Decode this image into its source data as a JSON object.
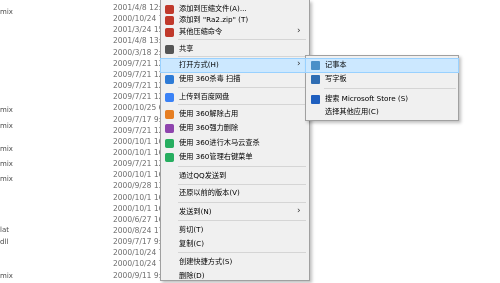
{
  "background": {
    "left_names": [
      "mix",
      "mix",
      "mix",
      "mix",
      "mix",
      "mix",
      "lat",
      "dll",
      "mix"
    ],
    "dates": [
      "2001/4/8 12:",
      "2000/10/24 7:",
      "2001/3/24 15:",
      "2001/4/8 13:",
      "2000/3/18 2:",
      "2009/7/21 12:",
      "2009/7/21 12:",
      "2009/7/21 12:",
      "2009/7/21 12:",
      "2000/10/25 6:",
      "2009/7/17 9:",
      "2009/7/21 12:",
      "2000/10/1 16:",
      "2000/10/1 16:",
      "2009/7/21 12:",
      "2000/10/1 16:",
      "2000/9/28 13:",
      "2000/10/1 16:",
      "2000/10/1 16:",
      "2000/6/27 16:",
      "2000/8/24 17:",
      "2009/7/17 9:",
      "2000/10/24 7:",
      "2000/10/24 7:",
      "2000/9/11 9:"
    ]
  },
  "context_menu": {
    "items": [
      {
        "label": "添加到压缩文件(A)...",
        "icon": "winrar-icon",
        "color": "#c0392b",
        "arrow": false
      },
      {
        "label": "添加到 \"Ra2.zip\" (T)",
        "icon": "winrar-icon",
        "color": "#c0392b",
        "arrow": false
      },
      {
        "label": "其他压缩命令",
        "icon": "winrar-icon",
        "color": "#c0392b",
        "arrow": true
      },
      {
        "label": "共享",
        "icon": "share-icon",
        "color": "#555555",
        "arrow": false
      },
      {
        "label": "打开方式(H)",
        "icon": "",
        "color": "",
        "arrow": true,
        "hover": true
      },
      {
        "label": "使用 360杀毒 扫描",
        "icon": "360-antivirus-icon",
        "color": "#2e7bd6",
        "arrow": false
      },
      {
        "label": "上传到百度网盘",
        "icon": "baidu-netdisk-icon",
        "color": "#3b82f6",
        "arrow": false
      },
      {
        "label": "使用 360解除占用",
        "icon": "360-unlock-icon",
        "color": "#e67e22",
        "arrow": false
      },
      {
        "label": "使用 360强力删除",
        "icon": "360-delete-icon",
        "color": "#8e44ad",
        "arrow": false
      },
      {
        "label": "使用 360进行木马云查杀",
        "icon": "360-shield-icon",
        "color": "#27ae60",
        "arrow": false
      },
      {
        "label": "使用 360管理右键菜单",
        "icon": "360-shield-icon",
        "color": "#27ae60",
        "arrow": false
      },
      {
        "label": "通过QQ发送到",
        "icon": "",
        "color": "",
        "arrow": false
      },
      {
        "label": "还原以前的版本(V)",
        "icon": "",
        "color": "",
        "arrow": false
      },
      {
        "label": "发送到(N)",
        "icon": "",
        "color": "",
        "arrow": true
      },
      {
        "label": "剪切(T)",
        "icon": "",
        "color": "",
        "arrow": false
      },
      {
        "label": "复制(C)",
        "icon": "",
        "color": "",
        "arrow": false
      },
      {
        "label": "创建快捷方式(S)",
        "icon": "",
        "color": "",
        "arrow": false
      },
      {
        "label": "删除(D)",
        "icon": "",
        "color": "",
        "arrow": false
      }
    ]
  },
  "submenu": {
    "items": [
      {
        "label": "记事本",
        "icon": "notepad-icon",
        "color": "#4a90c8",
        "hover": true
      },
      {
        "label": "写字板",
        "icon": "wordpad-icon",
        "color": "#2f6db3"
      },
      {
        "label": "搜索 Microsoft Store (S)",
        "icon": "store-icon",
        "color": "#1f5fbf"
      },
      {
        "label": "选择其他应用(C)",
        "icon": "",
        "color": ""
      }
    ]
  }
}
